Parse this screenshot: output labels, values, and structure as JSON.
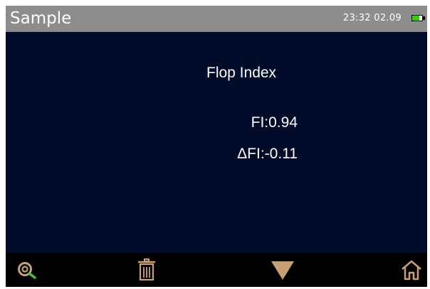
{
  "status_bar": {
    "title": "Sample",
    "time": "23:32",
    "date": "02.09",
    "battery_level": 0.7,
    "battery_icon": "battery-icon",
    "background_color": "#8d8d8d"
  },
  "measurement": {
    "heading": "Flop Index",
    "fi": "FI:0.94",
    "delta_fi": "ΔFI:-0.11"
  },
  "toolbar": {
    "items": [
      {
        "icon": "measure-target-icon"
      },
      {
        "icon": "trash-icon"
      },
      {
        "icon": "triangle-down-icon"
      },
      {
        "icon": "home-icon"
      }
    ],
    "icon_color": "#c8a074"
  },
  "colors": {
    "screen_background": "#000c2a",
    "toolbar_background": "#000000",
    "text": "#ffffff"
  }
}
